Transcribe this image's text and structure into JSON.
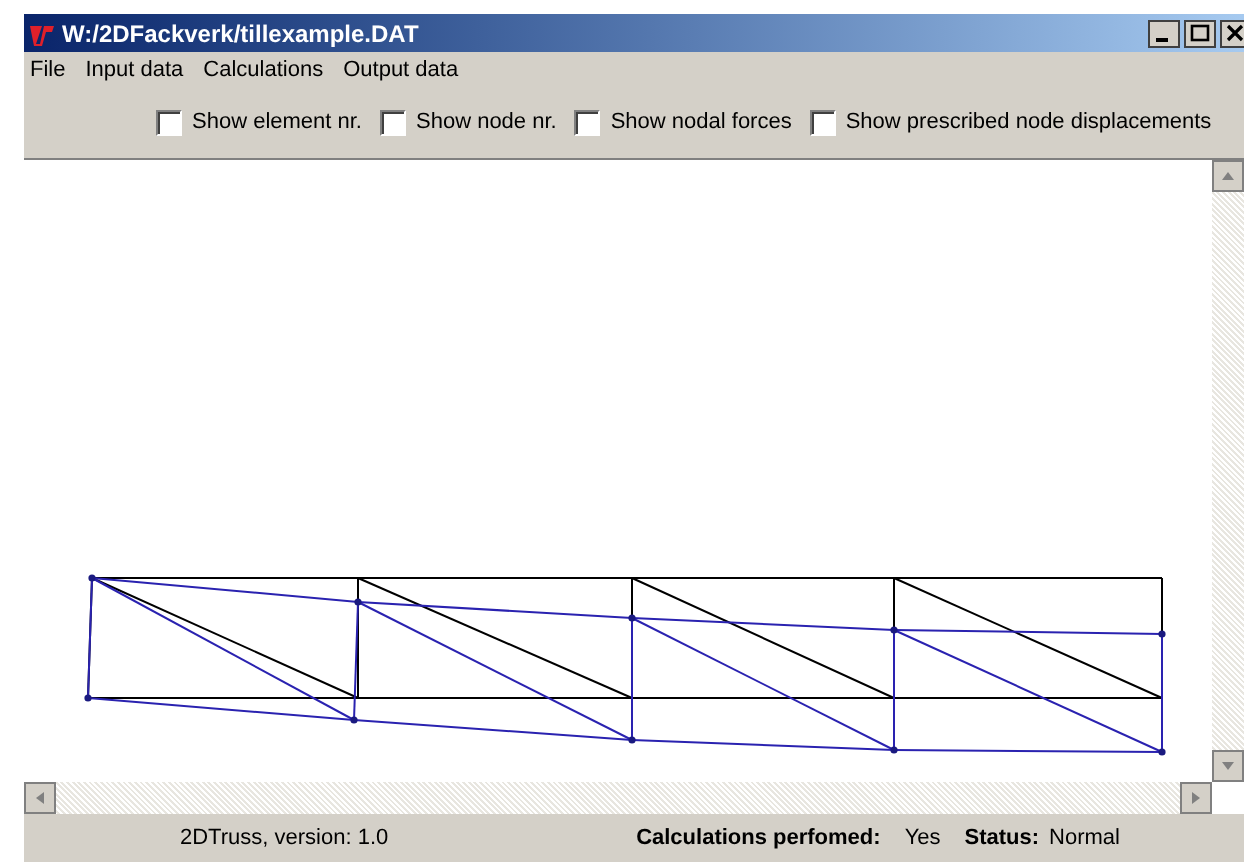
{
  "window": {
    "title": "W:/2DFackverk/tillexample.DAT"
  },
  "menu": [
    "File",
    "Input data",
    "Calculations",
    "Output data"
  ],
  "options": [
    {
      "label": "Show element nr.",
      "checked": false
    },
    {
      "label": "Show node nr.",
      "checked": false
    },
    {
      "label": "Show nodal forces",
      "checked": false
    },
    {
      "label": "Show prescribed node displacements",
      "checked": false
    }
  ],
  "status_bar": {
    "version": "2DTruss, version: 1.0",
    "calc_label": "Calculations perfomed:",
    "calc_value": "Yes",
    "status_label": "Status:",
    "status_value": "Normal"
  }
}
